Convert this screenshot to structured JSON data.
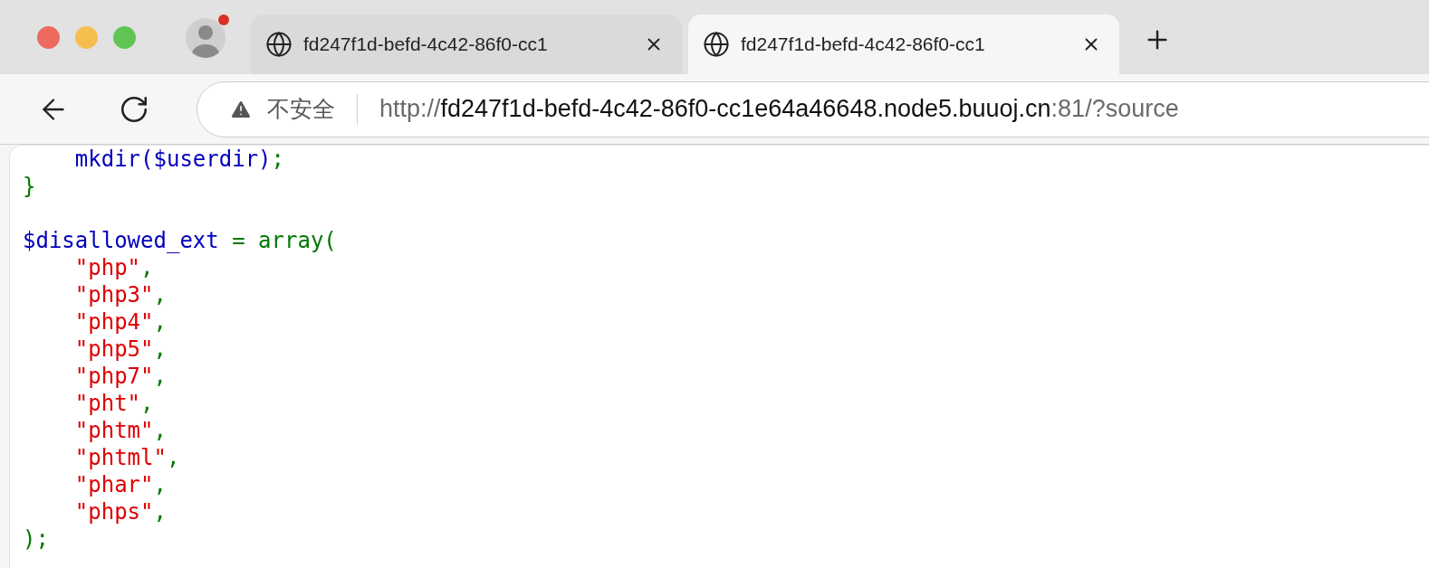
{
  "window": {
    "notification_dot": true
  },
  "tabs": [
    {
      "title": "fd247f1d-befd-4c42-86f0-cc1",
      "selected": false
    },
    {
      "title": "fd247f1d-befd-4c42-86f0-cc1",
      "selected": true
    }
  ],
  "address_bar": {
    "security": "不安全",
    "scheme": "http://",
    "host": "fd247f1d-befd-4c42-86f0-cc1e64a46648.node5.buuoj.cn",
    "rest": ":81/?source"
  },
  "code": {
    "lines": [
      {
        "kind": "code",
        "tokens": [
          {
            "kind": "default",
            "text": "    mkdir($userdir)"
          },
          {
            "kind": "keyword",
            "text": ";"
          }
        ]
      },
      {
        "kind": "code",
        "tokens": [
          {
            "kind": "keyword",
            "text": "}"
          }
        ]
      },
      {
        "kind": "blank"
      },
      {
        "kind": "code",
        "tokens": [
          {
            "kind": "default",
            "text": "$disallowed_ext "
          },
          {
            "kind": "keyword",
            "text": "= array("
          }
        ]
      },
      {
        "kind": "code",
        "tokens": [
          {
            "kind": "string",
            "text": "    \"php\""
          },
          {
            "kind": "keyword",
            "text": ","
          }
        ]
      },
      {
        "kind": "code",
        "tokens": [
          {
            "kind": "string",
            "text": "    \"php3\""
          },
          {
            "kind": "keyword",
            "text": ","
          }
        ]
      },
      {
        "kind": "code",
        "tokens": [
          {
            "kind": "string",
            "text": "    \"php4\""
          },
          {
            "kind": "keyword",
            "text": ","
          }
        ]
      },
      {
        "kind": "code",
        "tokens": [
          {
            "kind": "string",
            "text": "    \"php5\""
          },
          {
            "kind": "keyword",
            "text": ","
          }
        ]
      },
      {
        "kind": "code",
        "tokens": [
          {
            "kind": "string",
            "text": "    \"php7\""
          },
          {
            "kind": "keyword",
            "text": ","
          }
        ]
      },
      {
        "kind": "code",
        "tokens": [
          {
            "kind": "string",
            "text": "    \"pht\""
          },
          {
            "kind": "keyword",
            "text": ","
          }
        ]
      },
      {
        "kind": "code",
        "tokens": [
          {
            "kind": "string",
            "text": "    \"phtm\""
          },
          {
            "kind": "keyword",
            "text": ","
          }
        ]
      },
      {
        "kind": "code",
        "tokens": [
          {
            "kind": "string",
            "text": "    \"phtml\""
          },
          {
            "kind": "keyword",
            "text": ","
          }
        ]
      },
      {
        "kind": "code",
        "tokens": [
          {
            "kind": "string",
            "text": "    \"phar\""
          },
          {
            "kind": "keyword",
            "text": ","
          }
        ]
      },
      {
        "kind": "code",
        "tokens": [
          {
            "kind": "string",
            "text": "    \"phps\""
          },
          {
            "kind": "keyword",
            "text": ","
          }
        ]
      },
      {
        "kind": "code",
        "tokens": [
          {
            "kind": "keyword",
            "text": ");"
          }
        ]
      }
    ]
  }
}
